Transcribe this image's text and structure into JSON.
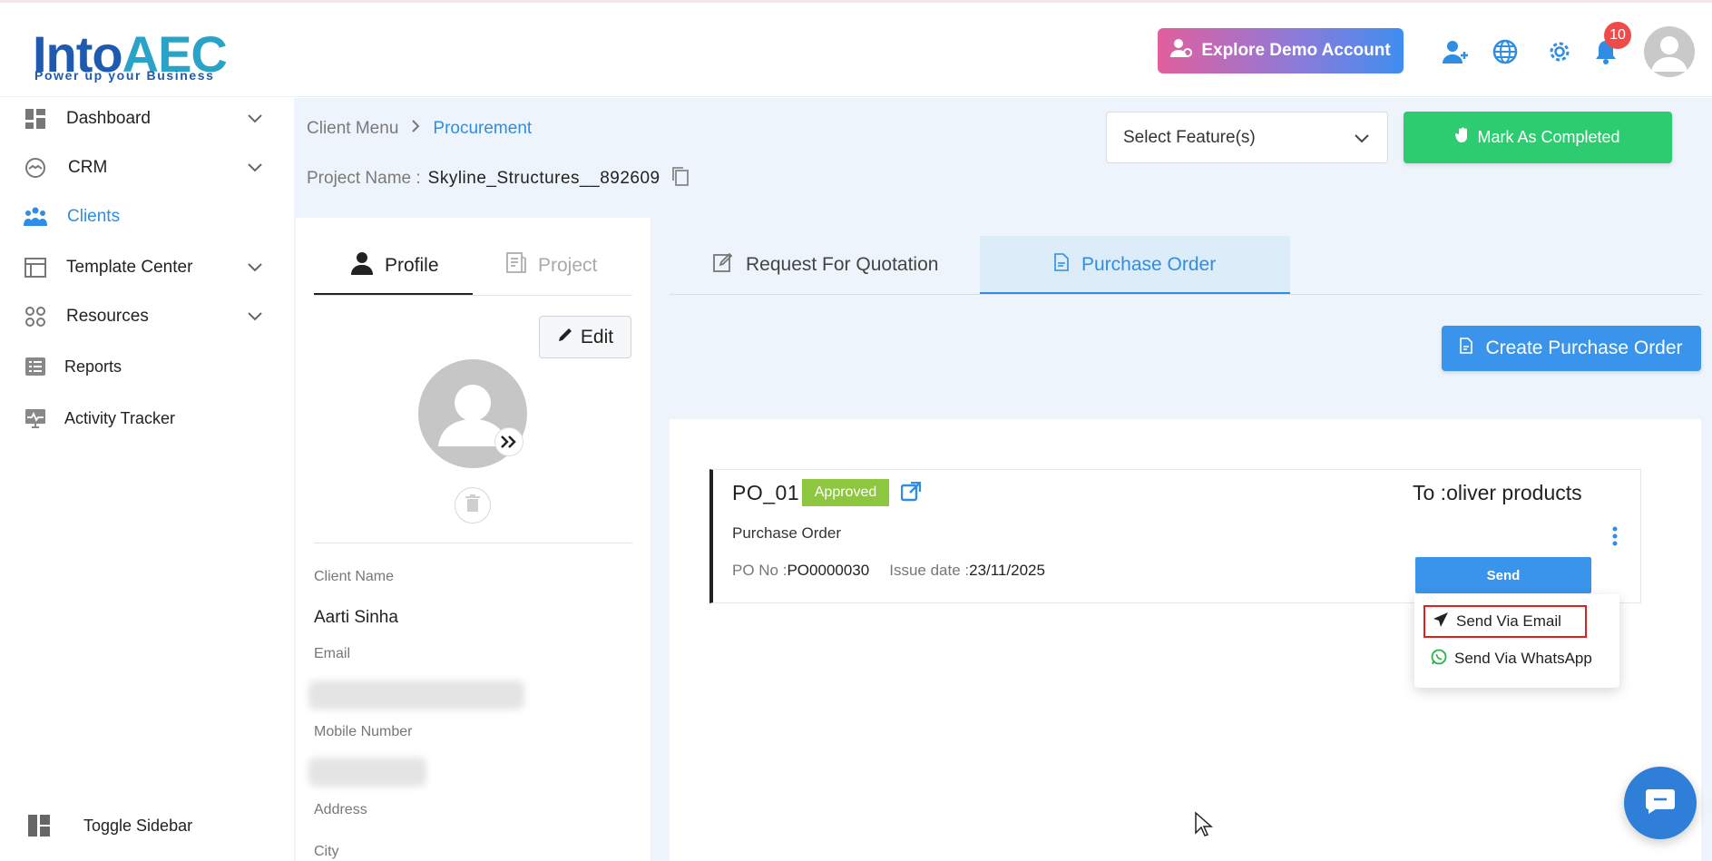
{
  "header": {
    "logo_text": "IntoAEC",
    "logo_tagline": "Power up your Business",
    "demo_button": "Explore Demo Account",
    "notification_count": "10"
  },
  "sidebar": {
    "items": [
      {
        "label": "Dashboard",
        "icon": "dashboard-icon",
        "has_chevron": true
      },
      {
        "label": "CRM",
        "icon": "handshake-icon",
        "has_chevron": true
      },
      {
        "label": "Clients",
        "icon": "clients-icon",
        "active": true
      },
      {
        "label": "Template Center",
        "icon": "template-icon",
        "has_chevron": true
      },
      {
        "label": "Resources",
        "icon": "resources-icon",
        "has_chevron": true
      },
      {
        "label": "Reports",
        "icon": "reports-icon"
      },
      {
        "label": "Activity Tracker",
        "icon": "activity-icon"
      }
    ],
    "toggle_label": "Toggle Sidebar"
  },
  "breadcrumb": {
    "root": "Client Menu",
    "current": "Procurement"
  },
  "project": {
    "label": "Project Name :",
    "value": "Skyline_Structures__892609"
  },
  "feature_select": {
    "selected": "Select Feature(s)"
  },
  "mark_completed": "Mark As Completed",
  "profile": {
    "tabs": [
      "Profile",
      "Project"
    ],
    "edit_label": "Edit",
    "fields": {
      "client_name_label": "Client Name",
      "client_name": "Aarti Sinha",
      "email_label": "Email",
      "mobile_label": "Mobile Number",
      "address_label": "Address",
      "city_label": "City"
    }
  },
  "procurement": {
    "tabs": [
      "Request For Quotation",
      "Purchase Order"
    ],
    "create_button": "Create Purchase Order",
    "po": {
      "title": "PO_01",
      "status": "Approved",
      "to": "To :oliver products",
      "type": "Purchase Order",
      "po_no_label": "PO No :",
      "po_no": "PO0000030",
      "issue_label": "Issue date :",
      "issue_date": "23/11/2025",
      "send_label": "Send",
      "send_menu": [
        "Send Via Email",
        "Send Via WhatsApp"
      ]
    }
  },
  "colors": {
    "accent": "#2f8de4",
    "success": "#2ecc71",
    "approved": "#8dc63f",
    "highlight": "#e02020"
  }
}
